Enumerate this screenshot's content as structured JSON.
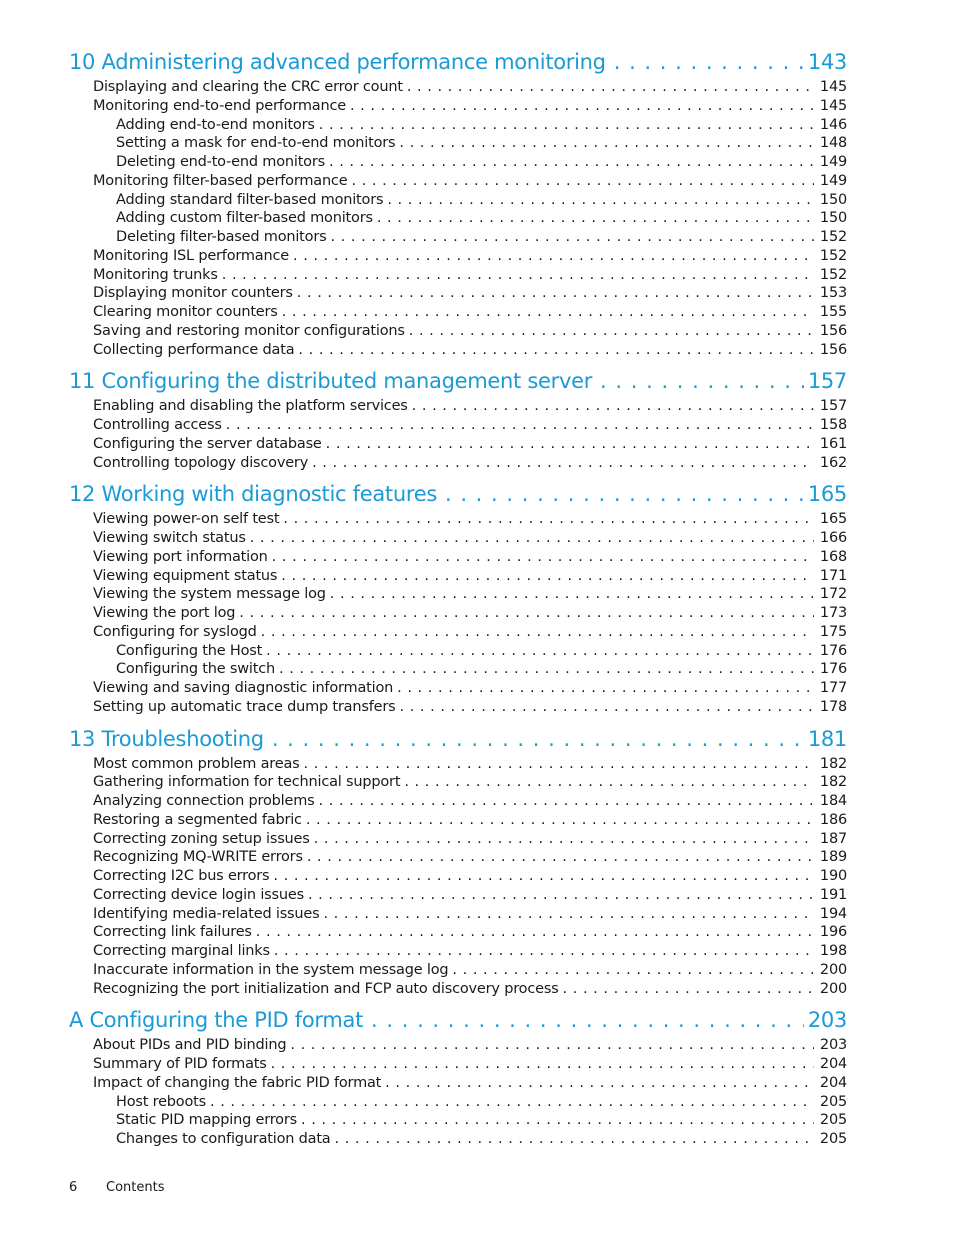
{
  "accent_color": "#1a9ad6",
  "chapters": [
    {
      "title": "10 Administering advanced performance monitoring",
      "page": "143",
      "entries": [
        {
          "level": 1,
          "title": "Displaying and clearing the CRC error count",
          "page": "145"
        },
        {
          "level": 1,
          "title": "Monitoring end-to-end performance",
          "page": "145"
        },
        {
          "level": 2,
          "title": "Adding end-to-end monitors",
          "page": "146"
        },
        {
          "level": 2,
          "title": "Setting a mask for end-to-end monitors",
          "page": "148"
        },
        {
          "level": 2,
          "title": "Deleting end-to-end monitors",
          "page": "149"
        },
        {
          "level": 1,
          "title": "Monitoring filter-based performance",
          "page": "149"
        },
        {
          "level": 2,
          "title": "Adding standard filter-based monitors",
          "page": "150"
        },
        {
          "level": 2,
          "title": "Adding custom filter-based monitors",
          "page": "150"
        },
        {
          "level": 2,
          "title": "Deleting filter-based monitors",
          "page": "152"
        },
        {
          "level": 1,
          "title": "Monitoring ISL performance",
          "page": "152"
        },
        {
          "level": 1,
          "title": "Monitoring trunks",
          "page": "152"
        },
        {
          "level": 1,
          "title": "Displaying monitor counters",
          "page": "153"
        },
        {
          "level": 1,
          "title": "Clearing monitor counters",
          "page": "155"
        },
        {
          "level": 1,
          "title": "Saving and restoring monitor configurations",
          "page": "156"
        },
        {
          "level": 1,
          "title": "Collecting performance data",
          "page": "156"
        }
      ]
    },
    {
      "title": "11 Configuring the distributed management server",
      "page": "157",
      "entries": [
        {
          "level": 1,
          "title": "Enabling and disabling the platform services",
          "page": "157"
        },
        {
          "level": 1,
          "title": "Controlling access",
          "page": "158"
        },
        {
          "level": 1,
          "title": "Configuring the server database",
          "page": "161"
        },
        {
          "level": 1,
          "title": "Controlling topology discovery",
          "page": "162"
        }
      ]
    },
    {
      "title": "12 Working with diagnostic features",
      "page": "165",
      "entries": [
        {
          "level": 1,
          "title": "Viewing power-on self test",
          "page": "165"
        },
        {
          "level": 1,
          "title": "Viewing switch status",
          "page": "166"
        },
        {
          "level": 1,
          "title": "Viewing port information",
          "page": "168"
        },
        {
          "level": 1,
          "title": "Viewing equipment status",
          "page": "171"
        },
        {
          "level": 1,
          "title": "Viewing the system message log",
          "page": "172"
        },
        {
          "level": 1,
          "title": "Viewing the port log",
          "page": "173"
        },
        {
          "level": 1,
          "title": "Configuring for syslogd",
          "page": "175"
        },
        {
          "level": 2,
          "title": "Configuring the Host",
          "page": "176"
        },
        {
          "level": 2,
          "title": "Configuring the switch",
          "page": "176"
        },
        {
          "level": 1,
          "title": "Viewing and saving diagnostic information",
          "page": "177"
        },
        {
          "level": 1,
          "title": "Setting up automatic trace dump transfers",
          "page": "178"
        }
      ]
    },
    {
      "title": "13 Troubleshooting",
      "page": "181",
      "entries": [
        {
          "level": 1,
          "title": "Most common problem areas",
          "page": "182"
        },
        {
          "level": 1,
          "title": "Gathering information for technical support",
          "page": "182"
        },
        {
          "level": 1,
          "title": "Analyzing connection problems",
          "page": "184"
        },
        {
          "level": 1,
          "title": "Restoring a segmented fabric",
          "page": "186"
        },
        {
          "level": 1,
          "title": "Correcting zoning setup issues",
          "page": "187"
        },
        {
          "level": 1,
          "title": "Recognizing MQ-WRITE errors",
          "page": "189"
        },
        {
          "level": 1,
          "title": "Correcting I2C bus errors",
          "page": "190"
        },
        {
          "level": 1,
          "title": "Correcting device login issues",
          "page": "191"
        },
        {
          "level": 1,
          "title": "Identifying media-related issues",
          "page": "194"
        },
        {
          "level": 1,
          "title": "Correcting link failures",
          "page": "196"
        },
        {
          "level": 1,
          "title": "Correcting marginal links",
          "page": "198"
        },
        {
          "level": 1,
          "title": "Inaccurate information in the system message log",
          "page": "200"
        },
        {
          "level": 1,
          "title": "Recognizing the port initialization and FCP auto discovery process",
          "page": "200"
        }
      ]
    },
    {
      "title": "A  Configuring the PID format",
      "page": "203",
      "entries": [
        {
          "level": 1,
          "title": "About PIDs and PID binding",
          "page": "203"
        },
        {
          "level": 1,
          "title": "Summary of PID formats",
          "page": "204"
        },
        {
          "level": 1,
          "title": "Impact of changing the fabric PID format",
          "page": "204"
        },
        {
          "level": 2,
          "title": "Host reboots",
          "page": "205"
        },
        {
          "level": 2,
          "title": "Static PID mapping errors",
          "page": "205"
        },
        {
          "level": 2,
          "title": "Changes to configuration data",
          "page": "205"
        }
      ]
    }
  ],
  "footer": {
    "page_number": "6",
    "section": "Contents"
  }
}
